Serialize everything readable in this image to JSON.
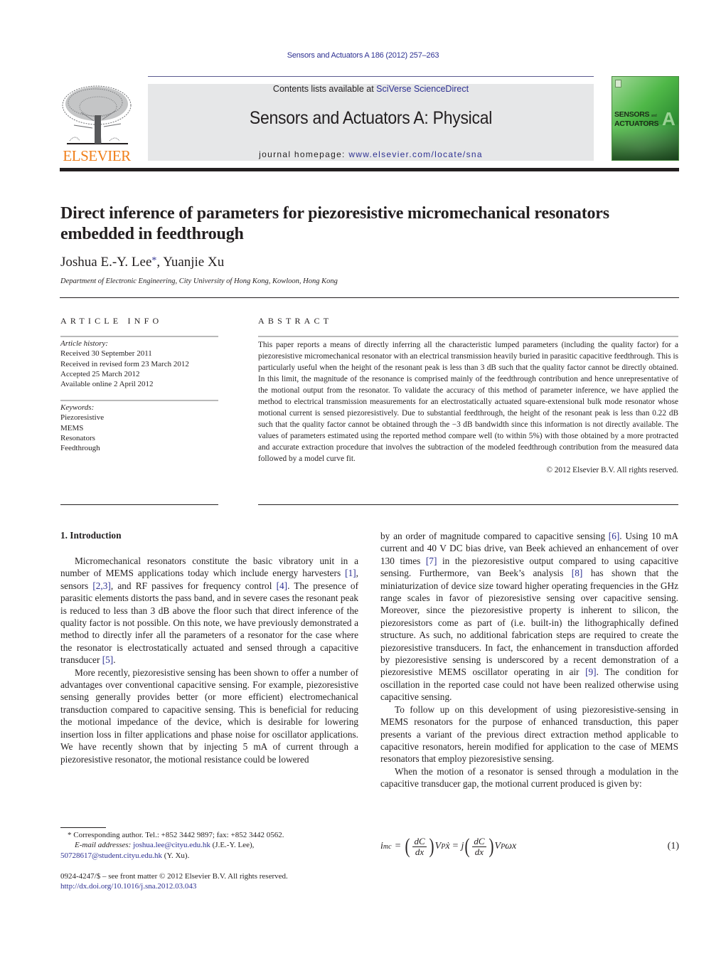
{
  "header": {
    "journal_ref": "Sensors and Actuators A 186 (2012) 257–263",
    "contents_prefix": "Contents lists available at ",
    "contents_link": "SciVerse ScienceDirect",
    "journal_name": "Sensors and Actuators A: Physical",
    "homepage_prefix": "journal homepage: ",
    "homepage_link": "www.elsevier.com/locate/sna",
    "publisher_logo_text": "ELSEVIER",
    "cover": {
      "title_line1": "SENSORS",
      "title_and": "and",
      "title_line2": "ACTUATORS",
      "letter": "A"
    },
    "colors": {
      "link": "#2e3192",
      "elsevier_orange": "#f07f1a",
      "masthead_bg": "#e6e7e8",
      "cover_green": "#4fb848"
    }
  },
  "article": {
    "title": "Direct inference of parameters for piezoresistive micromechanical resonators embedded in feedthrough",
    "authors": [
      {
        "name": "Joshua E.-Y. Lee",
        "mark": "*"
      },
      {
        "name": "Yuanjie Xu",
        "mark": ""
      }
    ],
    "author_separator": ", ",
    "affiliation": "Department of Electronic Engineering, City University of Hong Kong, Kowloon, Hong Kong"
  },
  "article_info": {
    "heading": "ARTICLE INFO",
    "history_label": "Article history:",
    "history": [
      "Received 30 September 2011",
      "Received in revised form 23 March 2012",
      "Accepted 25 March 2012",
      "Available online 2 April 2012"
    ],
    "keywords_label": "Keywords:",
    "keywords": [
      "Piezoresistive",
      "MEMS",
      "Resonators",
      "Feedthrough"
    ]
  },
  "abstract": {
    "heading": "ABSTRACT",
    "text": "This paper reports a means of directly inferring all the characteristic lumped parameters (including the quality factor) for a piezoresistive micromechanical resonator with an electrical transmission heavily buried in parasitic capacitive feedthrough. This is particularly useful when the height of the resonant peak is less than 3 dB such that the quality factor cannot be directly obtained. In this limit, the magnitude of the resonance is comprised mainly of the feedthrough contribution and hence unrepresentative of the motional output from the resonator. To validate the accuracy of this method of parameter inference, we have applied the method to electrical transmission measurements for an electrostatically actuated square-extensional bulk mode resonator whose motional current is sensed piezoresistively. Due to substantial feedthrough, the height of the resonant peak is less than 0.22 dB such that the quality factor cannot be obtained through the −3 dB bandwidth since this information is not directly available. The values of parameters estimated using the reported method compare well (to within 5%) with those obtained by a more protracted and accurate extraction procedure that involves the subtraction of the modeled feedthrough contribution from the measured data followed by a model curve fit.",
    "copyright": "© 2012 Elsevier B.V. All rights reserved."
  },
  "body": {
    "section_heading": "1.  Introduction",
    "left_col": {
      "p1": [
        {
          "t": "Micromechanical resonators constitute the basic vibratory unit in a number of MEMS applications today which include energy harvesters "
        },
        {
          "ref": "[1]"
        },
        {
          "t": ", sensors "
        },
        {
          "ref": "[2,3]"
        },
        {
          "t": ", and RF passives for frequency control "
        },
        {
          "ref": "[4]"
        },
        {
          "t": ". The presence of parasitic elements distorts the pass band, and in severe cases the resonant peak is reduced to less than 3 dB above the floor such that direct inference of the quality factor is not possible. On this note, we have previously demonstrated a method to directly infer all the parameters of a resonator for the case where the resonator is electrostatically actuated and sensed through a capacitive transducer "
        },
        {
          "ref": "[5]"
        },
        {
          "t": "."
        }
      ],
      "p2": "More recently, piezoresistive sensing has been shown to offer a number of advantages over conventional capacitive sensing. For example, piezoresistive sensing generally provides better (or more efficient) electromechanical transduction compared to capacitive sensing. This is beneficial for reducing the motional impedance of the device, which is desirable for lowering insertion loss in filter applications and phase noise for oscillator applications. We have recently shown that by injecting 5 mA of current through a piezoresistive resonator, the motional resistance could be lowered"
    },
    "right_col": {
      "p1": [
        {
          "t": "by an order of magnitude compared to capacitive sensing "
        },
        {
          "ref": "[6]"
        },
        {
          "t": ". Using 10 mA current and 40 V DC bias drive, van Beek achieved an enhancement of over 130 times "
        },
        {
          "ref": "[7]"
        },
        {
          "t": " in the piezoresistive output compared to using capacitive sensing. Furthermore, van Beek’s analysis "
        },
        {
          "ref": "[8]"
        },
        {
          "t": " has shown that the miniaturization of device size toward higher operating frequencies in the GHz range scales in favor of piezoresistive sensing over capacitive sensing. Moreover, since the piezoresistive property is inherent to silicon, the piezoresistors come as part of (i.e. built-in) the lithographically defined structure. As such, no additional fabrication steps are required to create the piezoresistive transducers. In fact, the enhancement in transduction afforded by piezoresistive sensing is underscored by a recent demonstration of a piezoresistive MEMS oscillator operating in air "
        },
        {
          "ref": "[9]"
        },
        {
          "t": ". The condition for oscillation in the reported case could not have been realized otherwise using capacitive sensing."
        }
      ],
      "p2": "To follow up on this development of using piezoresistive-sensing in MEMS resonators for the purpose of enhanced transduction, this paper presents a variant of the previous direct extraction method applicable to capacitive resonators, herein modified for application to the case of MEMS resonators that employ piezoresistive sensing.",
      "p3": "When the motion of a resonator is sensed through a modulation in the capacitive transducer gap, the motional current produced is given by:"
    },
    "equation": {
      "lhs": "i",
      "lhs_sub": "mc",
      "equals": "=",
      "frac_num": "dC",
      "frac_den": "dx",
      "vp": "V",
      "vp_sub": "P",
      "xdot": "ẋ",
      "j": "j",
      "omega_x": "ωx",
      "number": "(1)"
    }
  },
  "footnotes": {
    "star": "*",
    "corresponding": "Corresponding author. Tel.: +852 3442 9897; fax: +852 3442 0562.",
    "email_label": "E-mail addresses:",
    "email1": "joshua.lee@cityu.edu.hk",
    "email1_owner": " (J.E.-Y. Lee),",
    "email2": "50728617@student.cityu.edu.hk",
    "email2_owner": " (Y. Xu).",
    "front_matter": "0924-4247/$ – see front matter © 2012 Elsevier B.V. All rights reserved.",
    "doi": "http://dx.doi.org/10.1016/j.sna.2012.03.043"
  }
}
